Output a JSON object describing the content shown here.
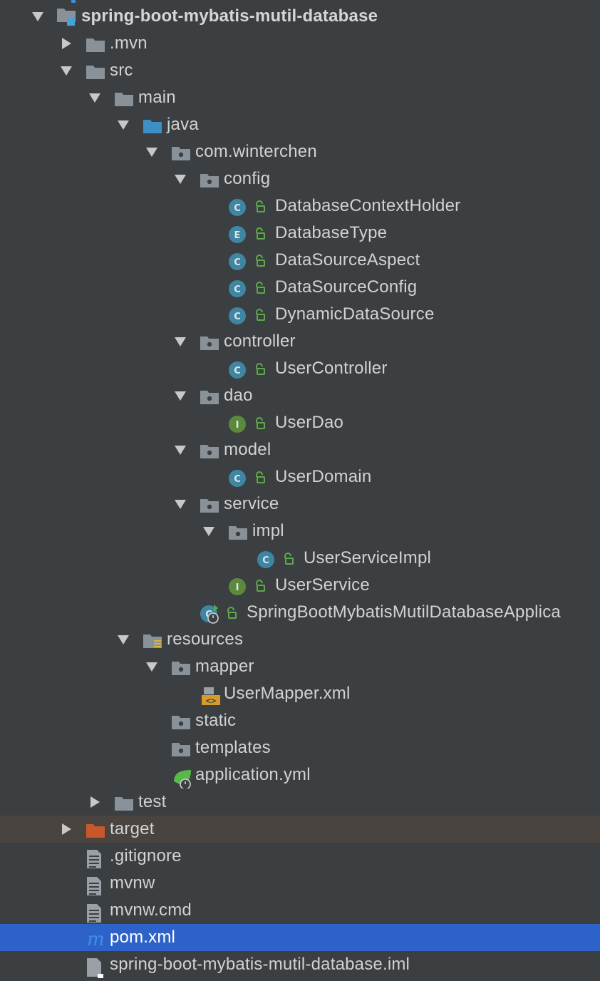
{
  "project_tree": {
    "nodes": [
      {
        "label": "spring-boot-mybatis-mutil-database",
        "depth": 0,
        "arrow": "down",
        "icon": "project-module-icon",
        "bold": true
      },
      {
        "label": ".mvn",
        "depth": 1,
        "arrow": "right",
        "icon": "folder-icon"
      },
      {
        "label": "src",
        "depth": 1,
        "arrow": "down",
        "icon": "folder-icon"
      },
      {
        "label": "main",
        "depth": 2,
        "arrow": "down",
        "icon": "folder-icon"
      },
      {
        "label": "java",
        "depth": 3,
        "arrow": "down",
        "icon": "source-folder-icon"
      },
      {
        "label": "com.winterchen",
        "depth": 4,
        "arrow": "down",
        "icon": "package-icon"
      },
      {
        "label": "config",
        "depth": 5,
        "arrow": "down",
        "icon": "package-icon"
      },
      {
        "label": "DatabaseContextHolder",
        "depth": 6,
        "arrow": "none",
        "icon": "class-icon",
        "badge": "C",
        "lock": true
      },
      {
        "label": "DatabaseType",
        "depth": 6,
        "arrow": "none",
        "icon": "enum-icon",
        "badge": "E",
        "lock": true
      },
      {
        "label": "DataSourceAspect",
        "depth": 6,
        "arrow": "none",
        "icon": "class-icon",
        "badge": "C",
        "lock": true
      },
      {
        "label": "DataSourceConfig",
        "depth": 6,
        "arrow": "none",
        "icon": "class-icon",
        "badge": "C",
        "lock": true
      },
      {
        "label": "DynamicDataSource",
        "depth": 6,
        "arrow": "none",
        "icon": "class-icon",
        "badge": "C",
        "lock": true
      },
      {
        "label": "controller",
        "depth": 5,
        "arrow": "down",
        "icon": "package-icon"
      },
      {
        "label": "UserController",
        "depth": 6,
        "arrow": "none",
        "icon": "class-icon",
        "badge": "C",
        "lock": true
      },
      {
        "label": "dao",
        "depth": 5,
        "arrow": "down",
        "icon": "package-icon"
      },
      {
        "label": "UserDao",
        "depth": 6,
        "arrow": "none",
        "icon": "interface-icon",
        "badge": "I",
        "lock": true
      },
      {
        "label": "model",
        "depth": 5,
        "arrow": "down",
        "icon": "package-icon"
      },
      {
        "label": "UserDomain",
        "depth": 6,
        "arrow": "none",
        "icon": "class-icon",
        "badge": "C",
        "lock": true
      },
      {
        "label": "service",
        "depth": 5,
        "arrow": "down",
        "icon": "package-icon"
      },
      {
        "label": "impl",
        "depth": 6,
        "arrow": "down",
        "icon": "package-icon"
      },
      {
        "label": "UserServiceImpl",
        "depth": 7,
        "arrow": "none",
        "icon": "class-icon",
        "badge": "C",
        "lock": true
      },
      {
        "label": "UserService",
        "depth": 6,
        "arrow": "none",
        "icon": "interface-icon",
        "badge": "I",
        "lock": true
      },
      {
        "label": "SpringBootMybatisMutilDatabaseApplica",
        "depth": 5,
        "arrow": "none",
        "icon": "spring-boot-class-icon",
        "badge": "C",
        "lock": true
      },
      {
        "label": "resources",
        "depth": 3,
        "arrow": "down",
        "icon": "resources-folder-icon"
      },
      {
        "label": "mapper",
        "depth": 4,
        "arrow": "down",
        "icon": "package-icon"
      },
      {
        "label": "UserMapper.xml",
        "depth": 5,
        "arrow": "none",
        "icon": "xml-file-icon"
      },
      {
        "label": "static",
        "depth": 4,
        "arrow": "none",
        "icon": "package-icon"
      },
      {
        "label": "templates",
        "depth": 4,
        "arrow": "none",
        "icon": "package-icon"
      },
      {
        "label": "application.yml",
        "depth": 4,
        "arrow": "none",
        "icon": "spring-yml-icon"
      },
      {
        "label": "test",
        "depth": 2,
        "arrow": "right",
        "icon": "folder-icon"
      },
      {
        "label": "target",
        "depth": 1,
        "arrow": "right",
        "icon": "excluded-folder-icon",
        "muted": true
      },
      {
        "label": ".gitignore",
        "depth": 1,
        "arrow": "none",
        "icon": "text-file-icon"
      },
      {
        "label": "mvnw",
        "depth": 1,
        "arrow": "none",
        "icon": "text-file-icon"
      },
      {
        "label": "mvnw.cmd",
        "depth": 1,
        "arrow": "none",
        "icon": "text-file-icon"
      },
      {
        "label": "pom.xml",
        "depth": 1,
        "arrow": "none",
        "icon": "maven-icon",
        "selected": true
      },
      {
        "label": "spring-boot-mybatis-mutil-database.iml",
        "depth": 1,
        "arrow": "none",
        "icon": "iml-file-icon"
      }
    ]
  },
  "colors": {
    "background": "#3c3f41",
    "selection": "#2d63c8",
    "excluded_row": "#4a4440",
    "folder": "#8a9299",
    "source_folder": "#3d8fc6",
    "class_badge": "#3f86a3",
    "interface_badge": "#5b8a3c",
    "lock": "#5ea84a",
    "excluded_folder": "#c8582a"
  }
}
